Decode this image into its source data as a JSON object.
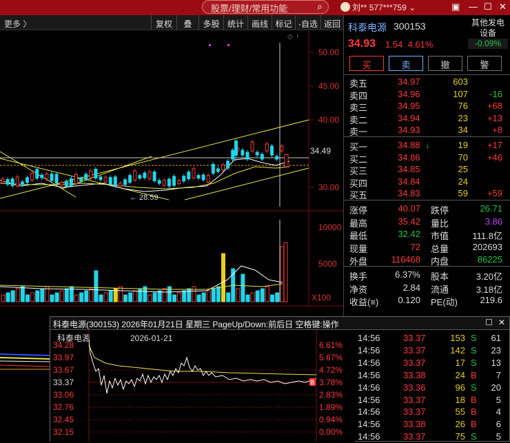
{
  "topbar": {
    "search_placeholder": "股票/理财/常用功能",
    "user_name": "刘**",
    "user_phone": "577***759",
    "win_icons": [
      "square-icon",
      "minimize-icon",
      "maximize-icon",
      "close-icon"
    ]
  },
  "toolbar": {
    "more_label": "更多 〉",
    "buttons": [
      "复权",
      "叠加",
      "多股",
      "统计",
      "画线",
      "标记",
      "-自选",
      "返回"
    ]
  },
  "chart": {
    "price_axis": [
      "50.00",
      "45.00",
      "40.00",
      "34.49",
      "30.00"
    ],
    "crosshair_value": "34.49",
    "low_label": "← 28.59",
    "volume_axis": [
      "10000",
      "5000",
      "X100"
    ],
    "colors": {
      "up": "#ff3b3b",
      "down": "#21d4e8",
      "ma_white": "#ffffff",
      "ma_yellow": "#e8e84a"
    }
  },
  "quote": {
    "name": "科泰电源",
    "code": "300153",
    "sector_line1": "其他发电",
    "sector_line2": "设备",
    "sector_pct": "-0.09%",
    "price": "34.93",
    "change": "1.54",
    "change_pct": "4.61%",
    "actions": [
      "买",
      "卖",
      "撤",
      "警"
    ],
    "asks": [
      {
        "label": "卖五",
        "price": "34.97",
        "vol": "603",
        "delta": ""
      },
      {
        "label": "卖四",
        "price": "34.96",
        "vol": "107",
        "delta": "-16"
      },
      {
        "label": "卖三",
        "price": "34.95",
        "vol": "76",
        "delta": "+68"
      },
      {
        "label": "卖二",
        "price": "34.94",
        "vol": "23",
        "delta": "+13"
      },
      {
        "label": "卖一",
        "price": "34.93",
        "vol": "34",
        "delta": "+8"
      }
    ],
    "bids": [
      {
        "label": "买一",
        "price": "34.88",
        "vol": "19",
        "delta": "+17",
        "arrow": "↓"
      },
      {
        "label": "买二",
        "price": "34.86",
        "vol": "70",
        "delta": "+46",
        "arrow": ""
      },
      {
        "label": "买三",
        "price": "34.85",
        "vol": "25",
        "delta": "",
        "arrow": ""
      },
      {
        "label": "买四",
        "price": "34.84",
        "vol": "24",
        "delta": "",
        "arrow": ""
      },
      {
        "label": "买五",
        "price": "34.83",
        "vol": "59",
        "delta": "+59",
        "arrow": ""
      }
    ],
    "stats1": [
      {
        "k1": "涨停",
        "v1": "40.07",
        "c1": "#ff3b3b",
        "k2": "跌停",
        "v2": "26.71",
        "c2": "#25c34a"
      },
      {
        "k1": "最高",
        "v1": "35.42",
        "c1": "#ff3b3b",
        "k2": "量比",
        "v2": "3.86",
        "c2": "#c040ff"
      },
      {
        "k1": "最低",
        "v1": "32.42",
        "c1": "#25c34a",
        "k2": "市值",
        "v2": "111.8亿",
        "c2": "#dddddd"
      },
      {
        "k1": "现量",
        "v1": "72",
        "c1": "#ff3b3b",
        "k2": "总量",
        "v2": "202693",
        "c2": "#dddddd"
      },
      {
        "k1": "外盘",
        "v1": "116468",
        "c1": "#ff3b3b",
        "k2": "内盘",
        "v2": "86225",
        "c2": "#25c34a"
      }
    ],
    "stats2": [
      {
        "k1": "换手",
        "v1": "6.37%",
        "k2": "股本",
        "v2": "3.20亿"
      },
      {
        "k1": "净资",
        "v1": "2.84",
        "k2": "流通",
        "v2": "3.18亿"
      },
      {
        "k1": "收益(≡)",
        "v1": "0.120",
        "k2": "PE(动)",
        "v2": "219.6"
      }
    ]
  },
  "popup": {
    "title": "科泰电源(300153)  2026年01月21日 星期三  PageUp/Down:前后日  空格键:操作",
    "subtitle_name": "科泰电源",
    "subtitle_date": "2026-01-21",
    "price_axis": [
      "34.28",
      "33.97",
      "33.67",
      "33.37",
      "33.06",
      "32.76",
      "32.45",
      "32.15"
    ],
    "pct_axis": [
      "6.61%",
      "5.67%",
      "4.72%",
      "3.78%",
      "2.83%",
      "1.89%",
      "0.94%",
      "0.00%"
    ],
    "marker": "B",
    "ticks": [
      {
        "time": "14:56",
        "price": "33.37",
        "vol": "153",
        "side": "S",
        "count": "61"
      },
      {
        "time": "14:56",
        "price": "33.37",
        "vol": "142",
        "side": "S",
        "count": "23"
      },
      {
        "time": "14:56",
        "price": "33.37",
        "vol": "17",
        "side": "S",
        "count": "13"
      },
      {
        "time": "14:56",
        "price": "33.38",
        "vol": "24",
        "side": "B",
        "count": "7"
      },
      {
        "time": "14:56",
        "price": "33.36",
        "vol": "96",
        "side": "S",
        "count": "20"
      },
      {
        "time": "14:56",
        "price": "33.37",
        "vol": "18",
        "side": "B",
        "count": "5"
      },
      {
        "time": "14:56",
        "price": "33.37",
        "vol": "55",
        "side": "B",
        "count": "4"
      },
      {
        "time": "14:56",
        "price": "33.38",
        "vol": "26",
        "side": "B",
        "count": "6"
      },
      {
        "time": "14:56",
        "price": "33.37",
        "vol": "75",
        "side": "S",
        "count": "5"
      }
    ]
  }
}
